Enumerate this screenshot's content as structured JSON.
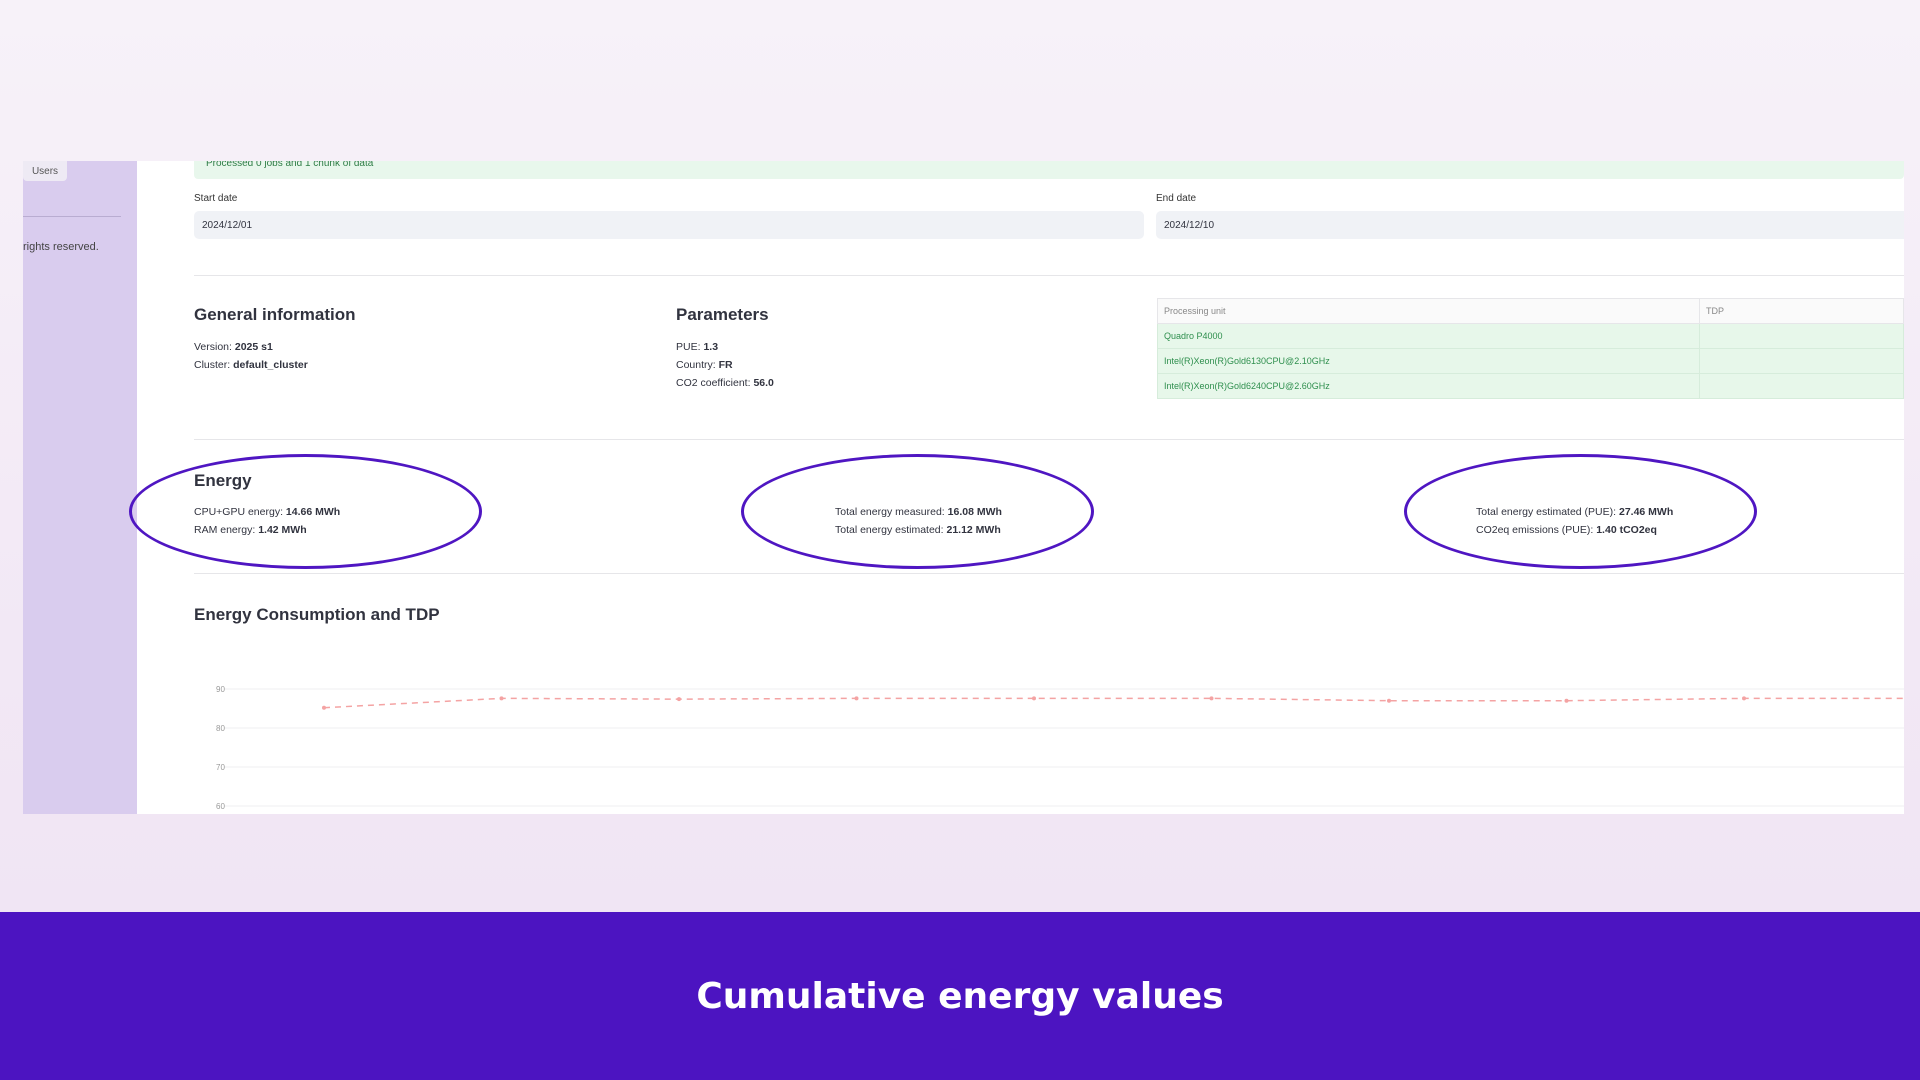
{
  "sidebar": {
    "users_tab": "Users",
    "footer": "rights reserved."
  },
  "info_bar": "Processed 0 jobs and 1 chunk of data",
  "dates": {
    "start_label": "Start date",
    "start_value": "2024/12/01",
    "end_label": "End date",
    "end_value": "2024/12/10"
  },
  "general": {
    "title": "General information",
    "version_label": "Version:",
    "version_value": "2025 s1",
    "cluster_label": "Cluster:",
    "cluster_value": "default_cluster"
  },
  "parameters": {
    "title": "Parameters",
    "pue_label": "PUE:",
    "pue_value": "1.3",
    "country_label": "Country:",
    "country_value": "FR",
    "co2_label": "CO2 coefficient:",
    "co2_value": "56.0"
  },
  "processing_table": {
    "headers": [
      "Processing unit",
      "TDP"
    ],
    "rows": [
      [
        "Quadro P4000",
        ""
      ],
      [
        "Intel(R)Xeon(R)Gold6130CPU@2.10GHz",
        ""
      ],
      [
        "Intel(R)Xeon(R)Gold6240CPU@2.60GHz",
        ""
      ]
    ]
  },
  "energy": {
    "title": "Energy",
    "cpu_gpu_label": "CPU+GPU energy:",
    "cpu_gpu_value": "14.66 MWh",
    "ram_label": "RAM energy:",
    "ram_value": "1.42 MWh",
    "measured_label": "Total energy measured:",
    "measured_value": "16.08 MWh",
    "estimated_label": "Total energy estimated:",
    "estimated_value": "21.12 MWh",
    "estimated_pue_label": "Total energy estimated (PUE):",
    "estimated_pue_value": "27.46 MWh",
    "co2_label": "CO2eq emissions (PUE):",
    "co2_value": "1.40 tCO2eq"
  },
  "consumption": {
    "title": "Energy Consumption and TDP"
  },
  "chart_data": {
    "type": "line",
    "y_ticks": [
      "90",
      "80",
      "70",
      "60"
    ],
    "ylim": [
      60,
      90
    ],
    "series": [
      {
        "values": [
          85.2,
          87.6,
          87.4,
          87.6,
          87.6,
          87.6,
          87.0,
          87.0,
          87.6,
          87.6
        ],
        "color": "#f4a3a3"
      }
    ]
  },
  "banner": {
    "title": "Cumulative energy values"
  },
  "colors": {
    "accent": "#4c14c1",
    "sidebar": "#d9ccee",
    "highlight": "#e7f7ea"
  }
}
